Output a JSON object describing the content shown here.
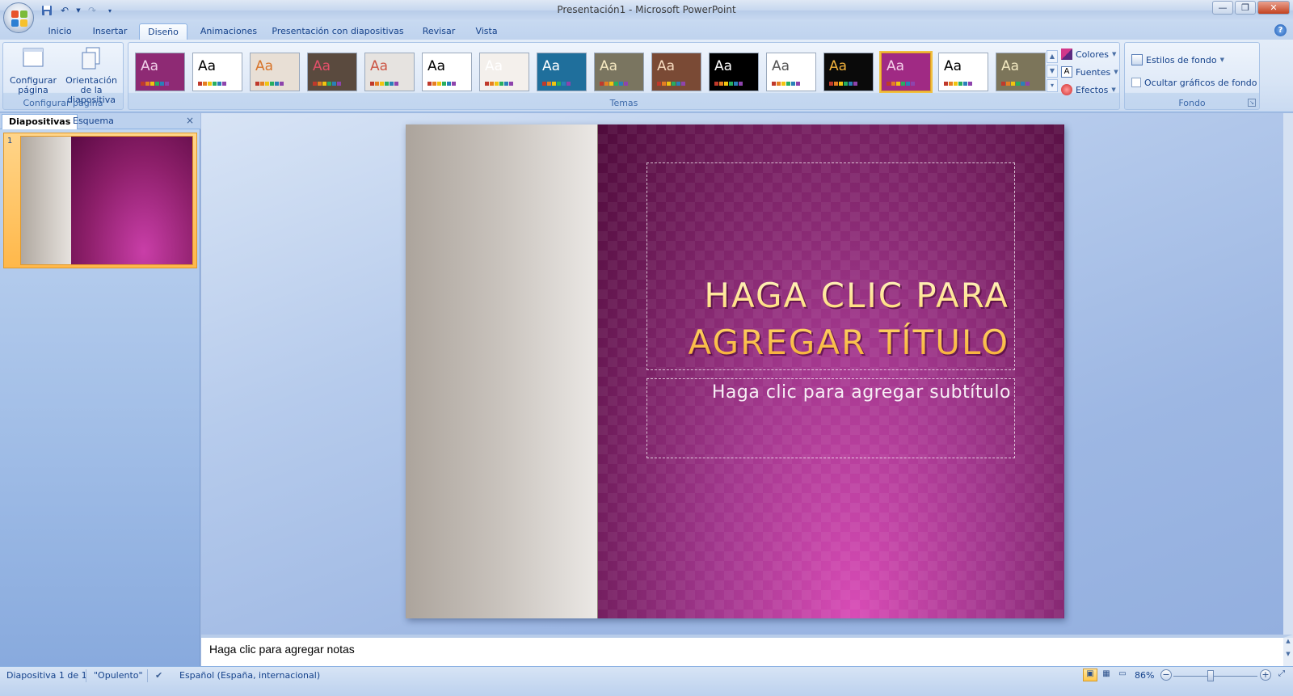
{
  "window": {
    "title": "Presentación1 - Microsoft PowerPoint"
  },
  "qat": {
    "icons": [
      "save-icon",
      "undo-icon",
      "redo-icon",
      "customize-icon"
    ]
  },
  "tabs": [
    {
      "label": "Inicio",
      "active": false
    },
    {
      "label": "Insertar",
      "active": false
    },
    {
      "label": "Diseño",
      "active": true
    },
    {
      "label": "Animaciones",
      "active": false
    },
    {
      "label": "Presentación con diapositivas",
      "active": false
    },
    {
      "label": "Revisar",
      "active": false
    },
    {
      "label": "Vista",
      "active": false
    }
  ],
  "ribbon": {
    "page_setup": {
      "configurar_label": "Configurar página",
      "orientacion_label": "Orientación de la diapositiva",
      "group_label": "Configurar página"
    },
    "themes": {
      "group_label": "Temas",
      "items": [
        {
          "label": "Aa",
          "bg": "#8e2a74",
          "fg": "#f0d0e8",
          "selected": false
        },
        {
          "label": "Aa",
          "bg": "#ffffff",
          "fg": "#000000",
          "selected": false
        },
        {
          "label": "Aa",
          "bg": "#e8dfd5",
          "fg": "#d7742a",
          "selected": false
        },
        {
          "label": "Aa",
          "bg": "#5a4a3e",
          "fg": "#e2506a",
          "selected": false
        },
        {
          "label": "Aa",
          "bg": "#e6e3e0",
          "fg": "#cc5544",
          "selected": false
        },
        {
          "label": "Aa",
          "bg": "#ffffff",
          "fg": "#000000",
          "selected": false
        },
        {
          "label": "Aa",
          "bg": "#f4f0ec",
          "fg": "#ffffff",
          "selected": false
        },
        {
          "label": "Aa",
          "bg": "#1f6f9c",
          "fg": "#ffffff",
          "selected": false
        },
        {
          "label": "Aa",
          "bg": "#7a7560",
          "fg": "#f5e8c0",
          "selected": false
        },
        {
          "label": "Aa",
          "bg": "#7a4a35",
          "fg": "#f7dcc0",
          "selected": false
        },
        {
          "label": "Aa",
          "bg": "#000000",
          "fg": "#ffffff",
          "selected": false
        },
        {
          "label": "Aa",
          "bg": "#ffffff",
          "fg": "#555555",
          "selected": false
        },
        {
          "label": "Aa",
          "bg": "#0a0a0a",
          "fg": "#f2b23c",
          "selected": false
        },
        {
          "label": "Aa",
          "bg": "#a02a84",
          "fg": "#f5d0ea",
          "selected": true
        },
        {
          "label": "Aa",
          "bg": "#ffffff",
          "fg": "#000000",
          "selected": false
        },
        {
          "label": "Aa",
          "bg": "#7c755a",
          "fg": "#f2e8c0",
          "selected": false
        }
      ]
    },
    "theme_options": {
      "colores": "Colores",
      "fuentes": "Fuentes",
      "efectos": "Efectos"
    },
    "fondo": {
      "estilos": "Estilos de fondo",
      "ocultar": "Ocultar gráficos de fondo",
      "group_label": "Fondo"
    }
  },
  "left_pane": {
    "tab_slides": "Diapositivas",
    "tab_outline": "Esquema",
    "slide_number": "1"
  },
  "slide": {
    "title": "HAGA CLIC PARA AGREGAR TÍTULO",
    "subtitle": "Haga clic para agregar subtítulo"
  },
  "notes": {
    "placeholder": "Haga clic para agregar notas"
  },
  "status": {
    "slide_info": "Diapositiva 1 de 1",
    "theme_name": "\"Opulento\"",
    "language": "Español (España, internacional)",
    "zoom": "86%",
    "zoom_level_percent": 86
  },
  "colors": {
    "accent": "#15428b",
    "slide_magenta": "#8d1f6a",
    "title_gold": "#ffd76a"
  }
}
